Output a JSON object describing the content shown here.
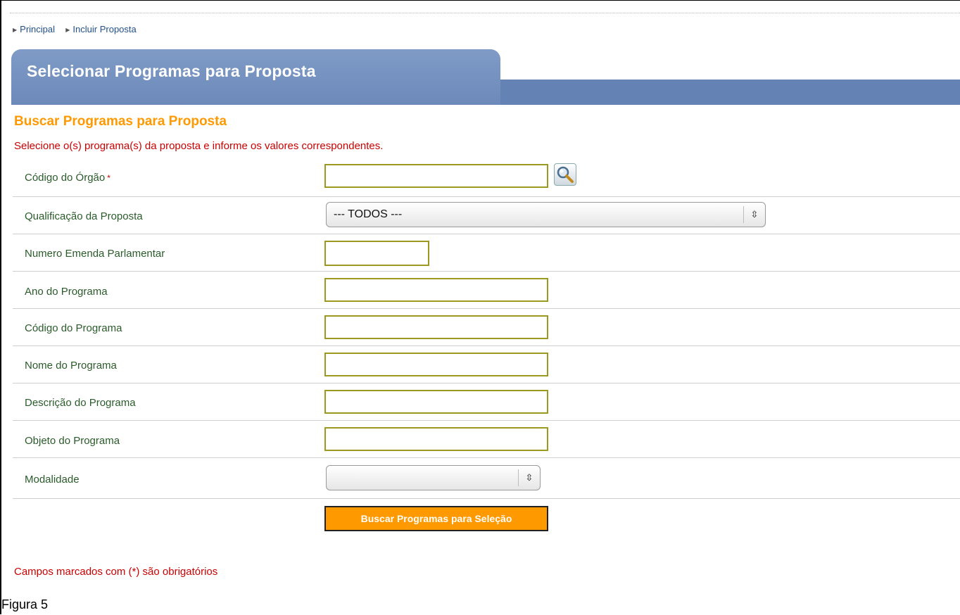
{
  "breadcrumb": {
    "items": [
      "Principal",
      "Incluir Proposta"
    ]
  },
  "header": {
    "title": "Selecionar Programas para Proposta"
  },
  "section": {
    "title": "Buscar Programas para Proposta",
    "instructions": "Selecione o(s) programa(s) da proposta e informe os valores correspondentes."
  },
  "form": {
    "fields": [
      {
        "label": "Código do Órgão",
        "required_marker": "*",
        "value": ""
      },
      {
        "label": "Qualificação da Proposta",
        "value": "--- TODOS ---"
      },
      {
        "label": "Numero Emenda Parlamentar",
        "value": ""
      },
      {
        "label": "Ano do Programa",
        "value": ""
      },
      {
        "label": "Código do Programa",
        "value": ""
      },
      {
        "label": "Nome do Programa",
        "value": ""
      },
      {
        "label": "Descrição do Programa",
        "value": ""
      },
      {
        "label": "Objeto do Programa",
        "value": ""
      },
      {
        "label": "Modalidade",
        "value": ""
      }
    ],
    "submit_label": "Buscar Programas para Seleção"
  },
  "footer": {
    "required_note": "Campos marcados com (*) são obrigatórios",
    "caption": "Figura 5"
  },
  "colors": {
    "accent_orange": "#ff9900",
    "banner_blue": "#6482b4",
    "error_red": "#cc0000",
    "label_green": "#2a5b2a",
    "input_border": "#9b9a1e"
  },
  "icons": {
    "lookup": "magnifier-icon",
    "select_chevron": "up-down-chevron-icon",
    "breadcrumb_arrow": "triangle-right-icon"
  }
}
